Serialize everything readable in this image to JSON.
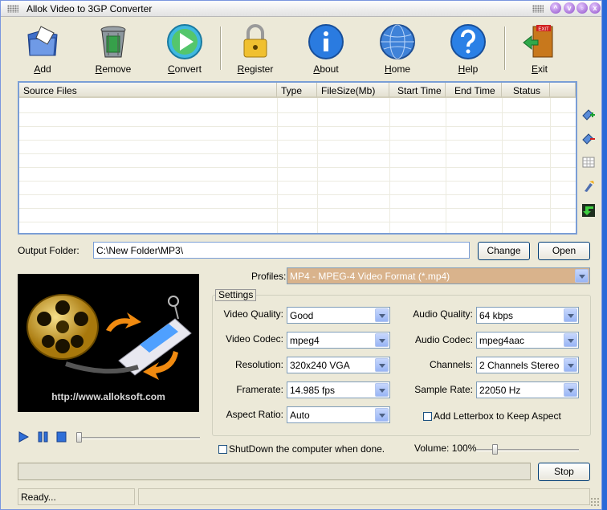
{
  "window": {
    "title": "Allok Video to 3GP Converter"
  },
  "toolbar": {
    "add": "Add",
    "remove": "Remove",
    "convert": "Convert",
    "register": "Register",
    "about": "About",
    "home": "Home",
    "help": "Help",
    "exit": "Exit"
  },
  "file_list": {
    "columns": [
      "Source Files",
      "Type",
      "FileSize(Mb)",
      "Start Time",
      "End Time",
      "Status"
    ]
  },
  "output": {
    "label": "Output Folder:",
    "value": "C:\\New Folder\\MP3\\",
    "change": "Change",
    "open": "Open"
  },
  "profiles": {
    "label": "Profiles:",
    "value": "MP4 - MPEG-4 Video Format (*.mp4)"
  },
  "preview": {
    "url": "http://www.alloksoft.com",
    "logo_text": "EXIT"
  },
  "settings": {
    "title": "Settings",
    "video_quality": {
      "label": "Video Quality:",
      "value": "Good"
    },
    "video_codec": {
      "label": "Video Codec:",
      "value": "mpeg4"
    },
    "resolution": {
      "label": "Resolution:",
      "value": "320x240 VGA"
    },
    "framerate": {
      "label": "Framerate:",
      "value": "14.985 fps"
    },
    "aspect_ratio": {
      "label": "Aspect Ratio:",
      "value": "Auto"
    },
    "audio_quality": {
      "label": "Audio Quality:",
      "value": "64  kbps"
    },
    "audio_codec": {
      "label": "Audio Codec:",
      "value": "mpeg4aac"
    },
    "channels": {
      "label": "Channels:",
      "value": "2 Channels Stereo"
    },
    "sample_rate": {
      "label": "Sample Rate:",
      "value": "22050 Hz"
    },
    "letterbox": {
      "label": "Add Letterbox to Keep Aspect",
      "checked": false
    }
  },
  "player": {
    "seek_position": 0
  },
  "shutdown": {
    "label": "ShutDown the computer when done.",
    "checked": false
  },
  "volume": {
    "label": "Volume: 100%",
    "level": 100
  },
  "stop_button": "Stop",
  "progress": {
    "value": 0
  },
  "status": {
    "text": "Ready..."
  },
  "colors": {
    "list_border": "#7a9ed6",
    "profile_bg": "#d9b38c",
    "titlebar_buttons": "#8e4fc8"
  }
}
